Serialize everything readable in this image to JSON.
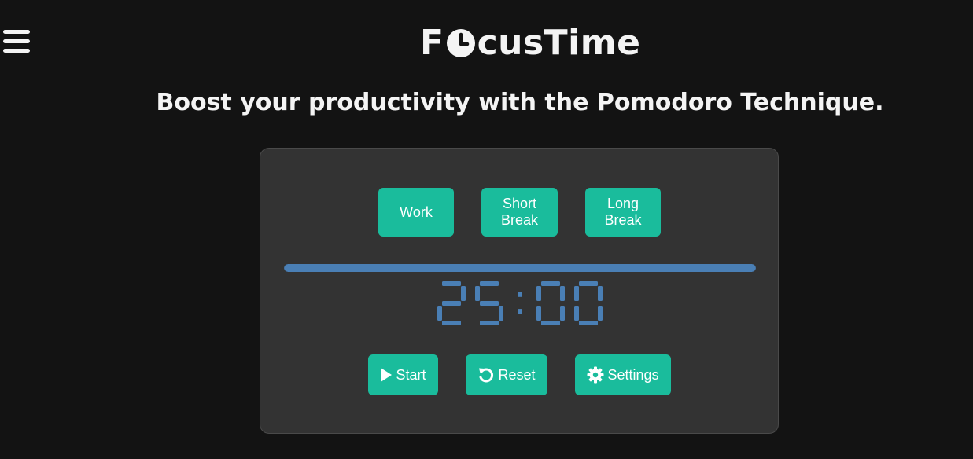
{
  "app": {
    "logo_prefix": "F",
    "logo_suffix": "cusTime",
    "logo_clock_icon": "clock-icon",
    "tagline": "Boost your productivity with the Pomodoro Technique."
  },
  "header": {
    "menu_icon": "hamburger-menu-icon"
  },
  "modes": [
    {
      "line1": "Work",
      "line2": ""
    },
    {
      "line1": "Short",
      "line2": "Break"
    },
    {
      "line1": "Long",
      "line2": "Break"
    }
  ],
  "timer": {
    "display": "25:00",
    "progress": 1.0
  },
  "controls": {
    "start_label": "Start",
    "start_icon": "play-icon",
    "reset_label": "Reset",
    "reset_icon": "reset-icon",
    "settings_label": "Settings",
    "settings_icon": "gear-icon"
  },
  "colors": {
    "background": "#131313",
    "panel": "#333333",
    "accent": "#1abc9c",
    "timer": "#4a7fb5",
    "text": "#f4f4f4"
  }
}
